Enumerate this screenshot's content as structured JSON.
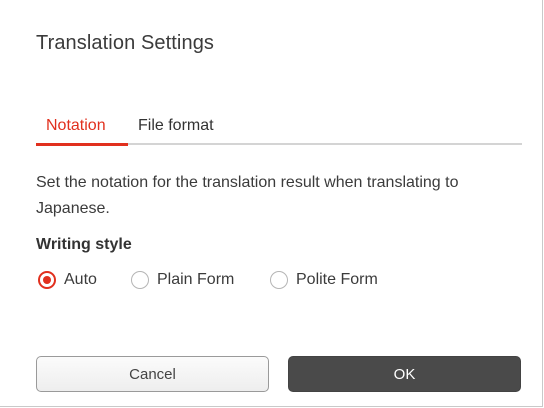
{
  "dialog": {
    "title": "Translation Settings"
  },
  "tabs": [
    {
      "label": "Notation",
      "active": true
    },
    {
      "label": "File format",
      "active": false
    }
  ],
  "description": "Set the notation for the translation result when translating to Japanese.",
  "writing_style": {
    "label": "Writing style",
    "options": [
      {
        "label": "Auto",
        "selected": true
      },
      {
        "label": "Plain Form",
        "selected": false
      },
      {
        "label": "Polite Form",
        "selected": false
      }
    ]
  },
  "buttons": {
    "cancel_label": "Cancel",
    "ok_label": "OK"
  },
  "colors": {
    "accent": "#e1301e",
    "primary_button": "#4a4a4a",
    "text": "#3b3b3b"
  }
}
